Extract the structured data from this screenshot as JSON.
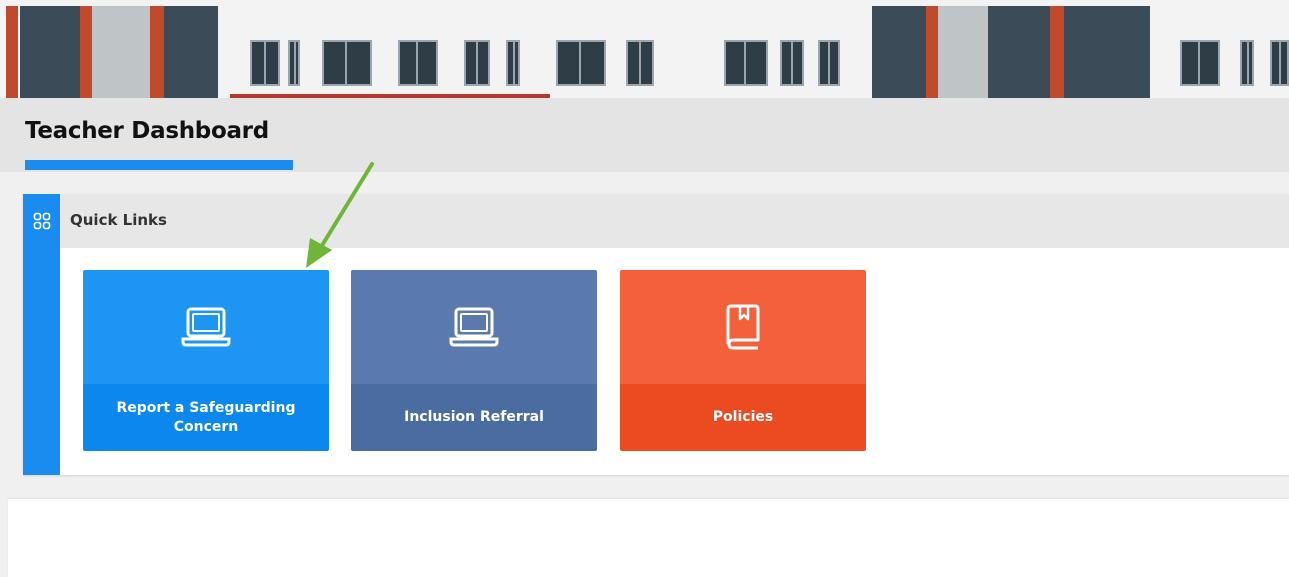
{
  "page": {
    "title": "Teacher Dashboard"
  },
  "quick_links": {
    "title": "Quick Links",
    "icon": "grid-icon",
    "tiles": [
      {
        "label": "Report a Safeguarding Concern",
        "icon": "laptop-icon",
        "color": "#1c96f2"
      },
      {
        "label": "Inclusion Referral",
        "icon": "laptop-icon",
        "color": "#5a79ad"
      },
      {
        "label": "Policies",
        "icon": "book-icon",
        "color": "#f2613c"
      }
    ]
  },
  "colors": {
    "accent": "#1a8cf0",
    "arrow": "#6fb53a"
  }
}
